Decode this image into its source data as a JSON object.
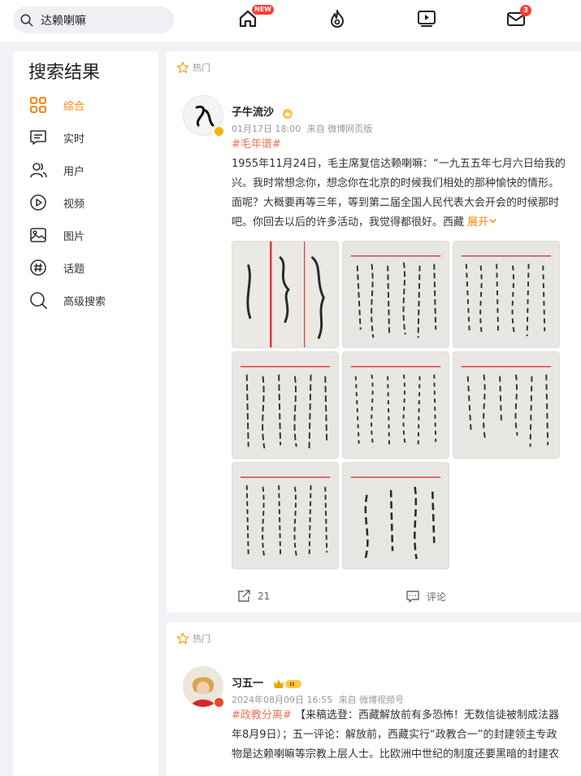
{
  "colors": {
    "accent": "#ff8200",
    "tag": "#eb7350",
    "badge": "#ff3b30"
  },
  "search": {
    "value": "达赖喇嘛"
  },
  "nav": {
    "home_badge": "NEW",
    "messages_badge": "3"
  },
  "sidebar": {
    "title": "搜索结果",
    "items": [
      {
        "label": "综合",
        "icon": "grid-icon",
        "active": true
      },
      {
        "label": "实时",
        "icon": "message-icon"
      },
      {
        "label": "用户",
        "icon": "users-icon"
      },
      {
        "label": "视频",
        "icon": "play-icon"
      },
      {
        "label": "图片",
        "icon": "image-icon"
      },
      {
        "label": "话题",
        "icon": "hashtag-icon"
      },
      {
        "label": "高级搜索",
        "icon": "search-icon"
      }
    ]
  },
  "posts": [
    {
      "hot_label": "热门",
      "username": "子牛流沙",
      "time": "01月17日 18:00",
      "source": "来自 微博网页版",
      "hashtag": "#毛年谱#",
      "lines": [
        "1955年11月24日，毛主席复信达赖喇嘛：“一九五五年七月六日给我的",
        "兴。我时常想念你，想念你在北京的时候我们相处的那种愉快的情形。",
        "面呢？大概要再等三年，等到第二届全国人民代表大会开会的时候那时",
        "吧。你回去以后的许多活动，我觉得都很好。西藏 "
      ],
      "expand": "展开",
      "repost_count": "21",
      "comment_label": "评论"
    },
    {
      "hot_label": "热门",
      "username": "习五一",
      "time": "2024年08月09日 16:55",
      "source": "来自 微博视频号",
      "hashtag": "#政教分离#",
      "lines": [
        "【来稿选登：西藏解放前有多恐怖！无数信徒被制成法器",
        "年8月9日）；五一评论：解放前，西藏实行“政教合一”的封建领主专政",
        "物是达赖喇嘛等宗教上层人士。比欧洲中世纪的制度还要黑暗的封建农"
      ]
    }
  ]
}
